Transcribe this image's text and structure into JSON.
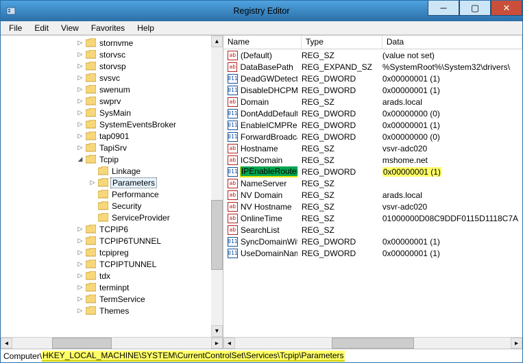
{
  "window": {
    "title": "Registry Editor"
  },
  "menu": {
    "file": "File",
    "edit": "Edit",
    "view": "View",
    "favorites": "Favorites",
    "help": "Help"
  },
  "tree": {
    "items": [
      {
        "depth": 0,
        "exp": "▷",
        "label": "stornvme"
      },
      {
        "depth": 0,
        "exp": "▷",
        "label": "storvsc"
      },
      {
        "depth": 0,
        "exp": "▷",
        "label": "storvsp"
      },
      {
        "depth": 0,
        "exp": "▷",
        "label": "svsvc"
      },
      {
        "depth": 0,
        "exp": "▷",
        "label": "swenum"
      },
      {
        "depth": 0,
        "exp": "▷",
        "label": "swprv"
      },
      {
        "depth": 0,
        "exp": "▷",
        "label": "SysMain"
      },
      {
        "depth": 0,
        "exp": "▷",
        "label": "SystemEventsBroker"
      },
      {
        "depth": 0,
        "exp": "▷",
        "label": "tap0901"
      },
      {
        "depth": 0,
        "exp": "▷",
        "label": "TapiSrv"
      },
      {
        "depth": 0,
        "exp": "◢",
        "label": "Tcpip"
      },
      {
        "depth": 1,
        "exp": "",
        "label": "Linkage"
      },
      {
        "depth": 1,
        "exp": "▷",
        "label": "Parameters",
        "selected": true
      },
      {
        "depth": 1,
        "exp": "",
        "label": "Performance"
      },
      {
        "depth": 1,
        "exp": "",
        "label": "Security"
      },
      {
        "depth": 1,
        "exp": "",
        "label": "ServiceProvider"
      },
      {
        "depth": 0,
        "exp": "▷",
        "label": "TCPIP6"
      },
      {
        "depth": 0,
        "exp": "▷",
        "label": "TCPIP6TUNNEL"
      },
      {
        "depth": 0,
        "exp": "▷",
        "label": "tcpipreg"
      },
      {
        "depth": 0,
        "exp": "▷",
        "label": "TCPIPTUNNEL"
      },
      {
        "depth": 0,
        "exp": "▷",
        "label": "tdx"
      },
      {
        "depth": 0,
        "exp": "▷",
        "label": "terminpt"
      },
      {
        "depth": 0,
        "exp": "▷",
        "label": "TermService"
      },
      {
        "depth": 0,
        "exp": "▷",
        "label": "Themes"
      }
    ]
  },
  "list": {
    "columns": {
      "name": "Name",
      "type": "Type",
      "data": "Data"
    },
    "rows": [
      {
        "icon": "ab",
        "name": "(Default)",
        "type": "REG_SZ",
        "data": "(value not set)"
      },
      {
        "icon": "ab",
        "name": "DataBasePath",
        "type": "REG_EXPAND_SZ",
        "data": "%SystemRoot%\\System32\\drivers\\"
      },
      {
        "icon": "bin",
        "name": "DeadGWDetect...",
        "type": "REG_DWORD",
        "data": "0x00000001 (1)"
      },
      {
        "icon": "bin",
        "name": "DisableDHCPMe...",
        "type": "REG_DWORD",
        "data": "0x00000001 (1)"
      },
      {
        "icon": "ab",
        "name": "Domain",
        "type": "REG_SZ",
        "data": "arads.local"
      },
      {
        "icon": "bin",
        "name": "DontAddDefault...",
        "type": "REG_DWORD",
        "data": "0x00000000 (0)"
      },
      {
        "icon": "bin",
        "name": "EnableICMPRedi...",
        "type": "REG_DWORD",
        "data": "0x00000001 (1)"
      },
      {
        "icon": "bin",
        "name": "ForwardBroadca...",
        "type": "REG_DWORD",
        "data": "0x00000000 (0)"
      },
      {
        "icon": "ab",
        "name": "Hostname",
        "type": "REG_SZ",
        "data": "vsvr-adc020"
      },
      {
        "icon": "ab",
        "name": "ICSDomain",
        "type": "REG_SZ",
        "data": "mshome.net"
      },
      {
        "icon": "bin",
        "name": "IPEnableRouter",
        "type": "REG_DWORD",
        "data": "0x00000001 (1)",
        "highlight": true
      },
      {
        "icon": "ab",
        "name": "NameServer",
        "type": "REG_SZ",
        "data": ""
      },
      {
        "icon": "ab",
        "name": "NV Domain",
        "type": "REG_SZ",
        "data": "arads.local"
      },
      {
        "icon": "ab",
        "name": "NV Hostname",
        "type": "REG_SZ",
        "data": "vsvr-adc020"
      },
      {
        "icon": "ab",
        "name": "OnlineTime",
        "type": "REG_SZ",
        "data": "01000000D08C9DDF0115D1118C7A"
      },
      {
        "icon": "ab",
        "name": "SearchList",
        "type": "REG_SZ",
        "data": ""
      },
      {
        "icon": "bin",
        "name": "SyncDomainWit...",
        "type": "REG_DWORD",
        "data": "0x00000001 (1)"
      },
      {
        "icon": "bin",
        "name": "UseDomainNam...",
        "type": "REG_DWORD",
        "data": "0x00000001 (1)"
      }
    ]
  },
  "status": {
    "prefix": "Computer\\",
    "path": "HKEY_LOCAL_MACHINE\\SYSTEM\\CurrentControlSet\\Services\\Tcpip\\Parameters"
  }
}
